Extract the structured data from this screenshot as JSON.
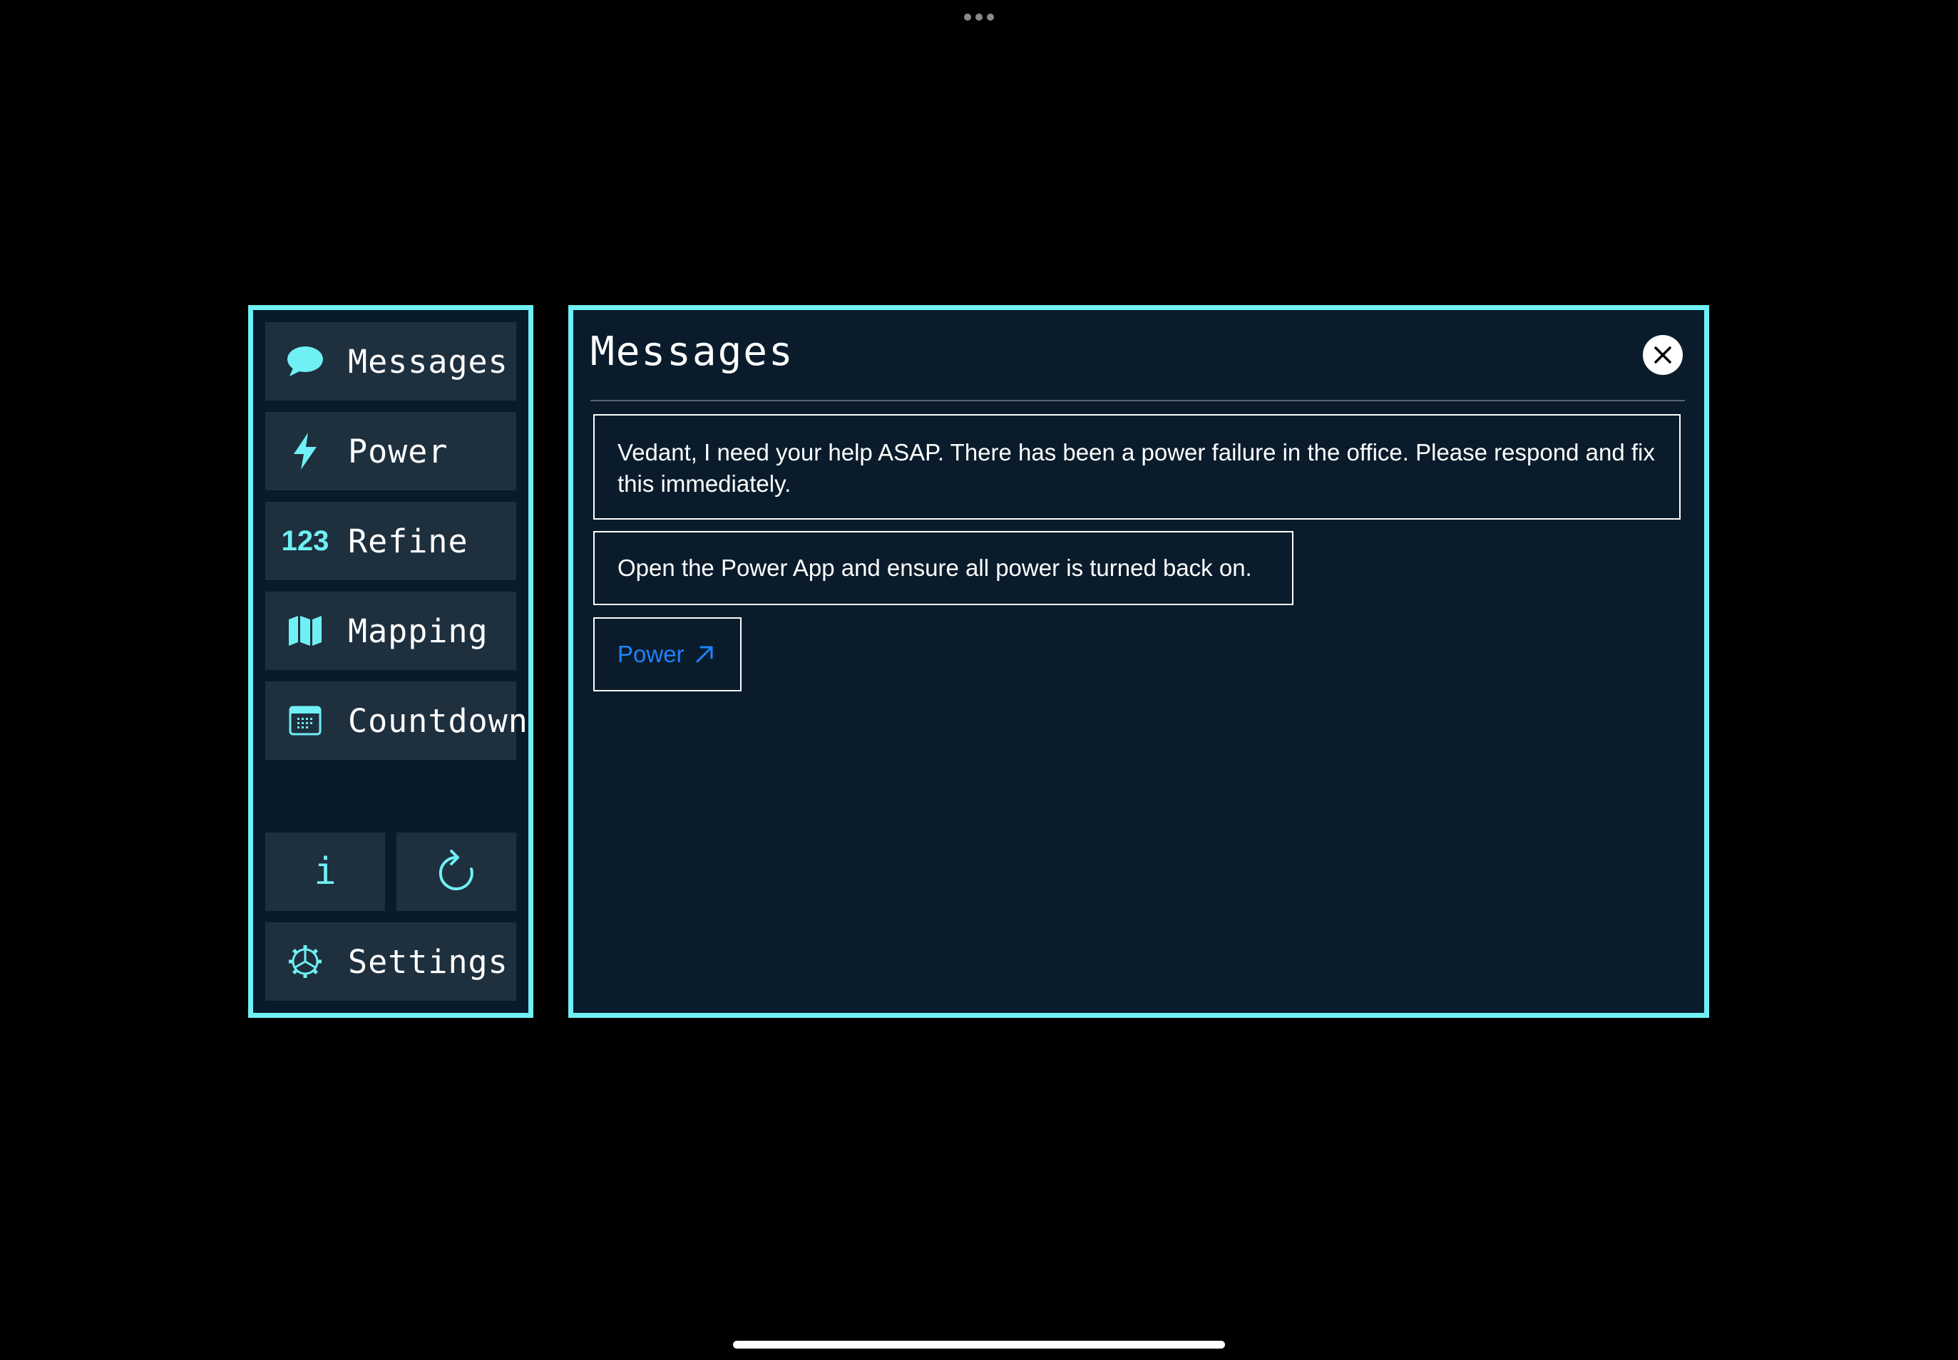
{
  "sidebar": {
    "items": [
      {
        "label": "Messages",
        "icon": "speech-bubble-icon"
      },
      {
        "label": "Power",
        "icon": "bolt-icon"
      },
      {
        "label": "Refine",
        "icon": "numbers-icon",
        "icon_text": "123"
      },
      {
        "label": "Mapping",
        "icon": "map-icon"
      },
      {
        "label": "Countdown",
        "icon": "calendar-icon"
      }
    ],
    "info_button": {
      "icon": "info-icon",
      "glyph": "i"
    },
    "refresh_button": {
      "icon": "refresh-icon"
    },
    "settings": {
      "label": "Settings",
      "icon": "gear-icon"
    }
  },
  "panel": {
    "title": "Messages",
    "close_label": "X",
    "messages": [
      "Vedant, I need your help ASAP. There has been a power failure in the office. Please respond and fix this immediately.",
      "Open the Power App and ensure all power is turned back on."
    ],
    "link": {
      "label": "Power",
      "icon": "arrow-up-right-icon"
    }
  },
  "colors": {
    "accent": "#6ff0f4",
    "panel_bg": "#0a1c2c",
    "nav_item_bg": "#1e2f3e",
    "link": "#1f82ff",
    "background": "#000000"
  }
}
